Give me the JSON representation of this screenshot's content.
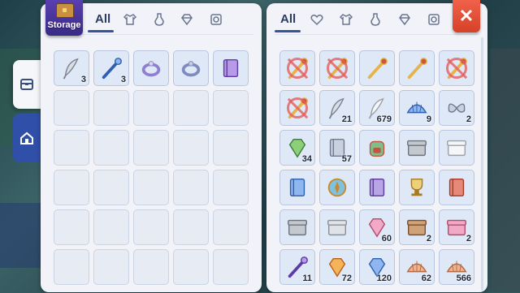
{
  "storage": {
    "badge_label": "Storage",
    "tabs": [
      {
        "label": "All",
        "active": true
      },
      {
        "icon": "shirt-icon"
      },
      {
        "icon": "potion-icon"
      },
      {
        "icon": "gem-icon"
      },
      {
        "icon": "card-icon"
      }
    ],
    "items": [
      {
        "icon": "feather-quill-icon",
        "qty": "3"
      },
      {
        "icon": "blue-wand-icon",
        "qty": "3"
      },
      {
        "icon": "ring-icon",
        "qty": ""
      },
      {
        "icon": "bracelet-icon",
        "qty": ""
      },
      {
        "icon": "purple-book-icon",
        "qty": ""
      }
    ],
    "empty_slots": 25
  },
  "inventory": {
    "tabs": [
      {
        "label": "All",
        "active": true
      },
      {
        "icon": "heart-icon"
      },
      {
        "icon": "shirt-icon"
      },
      {
        "icon": "potion-icon"
      },
      {
        "icon": "gem-icon"
      },
      {
        "icon": "card-icon"
      }
    ],
    "items": [
      {
        "icon": "mace-icon",
        "qty": "",
        "restricted": true
      },
      {
        "icon": "whip-icon",
        "qty": "",
        "restricted": true
      },
      {
        "icon": "staff-icon",
        "qty": ""
      },
      {
        "icon": "staff-icon",
        "qty": ""
      },
      {
        "icon": "sword-icon",
        "qty": "",
        "restricted": true
      },
      {
        "icon": "sword-icon",
        "qty": "",
        "restricted": true
      },
      {
        "icon": "feather-icon",
        "qty": "21"
      },
      {
        "icon": "white-feather-icon",
        "qty": "679"
      },
      {
        "icon": "blue-shell-icon",
        "qty": "9"
      },
      {
        "icon": "butterfly-wing-icon",
        "qty": "2"
      },
      {
        "icon": "green-crystal-icon",
        "qty": "34"
      },
      {
        "icon": "paper-note-icon",
        "qty": "57"
      },
      {
        "icon": "backpack-icon",
        "qty": ""
      },
      {
        "icon": "grey-box-icon",
        "qty": ""
      },
      {
        "icon": "white-box-icon",
        "qty": ""
      },
      {
        "icon": "blue-book-icon",
        "qty": ""
      },
      {
        "icon": "compass-icon",
        "qty": ""
      },
      {
        "icon": "open-book-icon",
        "qty": ""
      },
      {
        "icon": "trophy-icon",
        "qty": ""
      },
      {
        "icon": "red-book-icon",
        "qty": ""
      },
      {
        "icon": "grey-chest-icon",
        "qty": ""
      },
      {
        "icon": "silver-chest-icon",
        "qty": ""
      },
      {
        "icon": "pink-gem-icon",
        "qty": "60"
      },
      {
        "icon": "brown-box-icon",
        "qty": "2"
      },
      {
        "icon": "pink-box-icon",
        "qty": "2"
      },
      {
        "icon": "purple-sword-icon",
        "qty": "11"
      },
      {
        "icon": "orange-gem-icon",
        "qty": "72"
      },
      {
        "icon": "blue-gem-icon",
        "qty": "120"
      },
      {
        "icon": "shell-icon",
        "qty": "62"
      },
      {
        "icon": "seashell-icon",
        "qty": "566"
      }
    ]
  },
  "side_rail": [
    {
      "icon": "storage-tab-icon",
      "active": true
    },
    {
      "icon": "house-tab-icon",
      "active": false
    }
  ],
  "close_label": "✕",
  "colors": {
    "accent": "#35549e",
    "close": "#e04f34",
    "badge": "#4a34a0"
  }
}
